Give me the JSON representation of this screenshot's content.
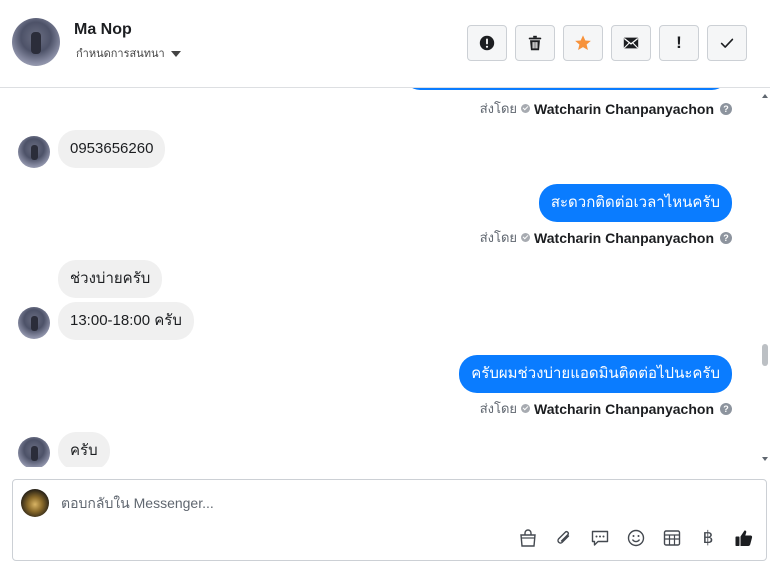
{
  "header": {
    "contact_name": "Ma Nop",
    "assign_label": "กำหนดการสนทนา",
    "actions": [
      {
        "id": "spam",
        "icon": "alert-circle-icon"
      },
      {
        "id": "delete",
        "icon": "trash-icon"
      },
      {
        "id": "star",
        "icon": "star-icon",
        "color": "#f7923b"
      },
      {
        "id": "mark-unread",
        "icon": "envelope-icon"
      },
      {
        "id": "follow-up",
        "icon": "exclamation-icon",
        "text": "!"
      },
      {
        "id": "done",
        "icon": "checkmark-icon"
      }
    ]
  },
  "sent_by": {
    "prefix": "ส่งโดย",
    "agent": "Watcharin Chanpanyachon"
  },
  "messages": [
    {
      "direction": "in",
      "text": "0953656260"
    },
    {
      "direction": "out",
      "text": "สะดวกติดต่อเวลาไหนครับ"
    },
    {
      "direction": "in",
      "text": "ช่วงบ่ายครับ"
    },
    {
      "direction": "in",
      "text": "13:00-18:00 ครับ"
    },
    {
      "direction": "out",
      "text": "ครับผมช่วงบ่ายแอดมินติดต่อไปนะครับ"
    },
    {
      "direction": "in",
      "text": "ครับ"
    }
  ],
  "composer": {
    "placeholder": "ตอบกลับใน Messenger...",
    "value": "",
    "tools": [
      "shopping-bag-icon",
      "paperclip-icon",
      "saved-reply-icon",
      "emoji-icon",
      "table-icon",
      "baht-icon",
      "thumbs-up-icon"
    ],
    "baht_symbol": "฿"
  },
  "colors": {
    "outgoing_bubble": "#0a7cff",
    "incoming_bubble": "#f0f0f0",
    "star": "#f7923b"
  }
}
